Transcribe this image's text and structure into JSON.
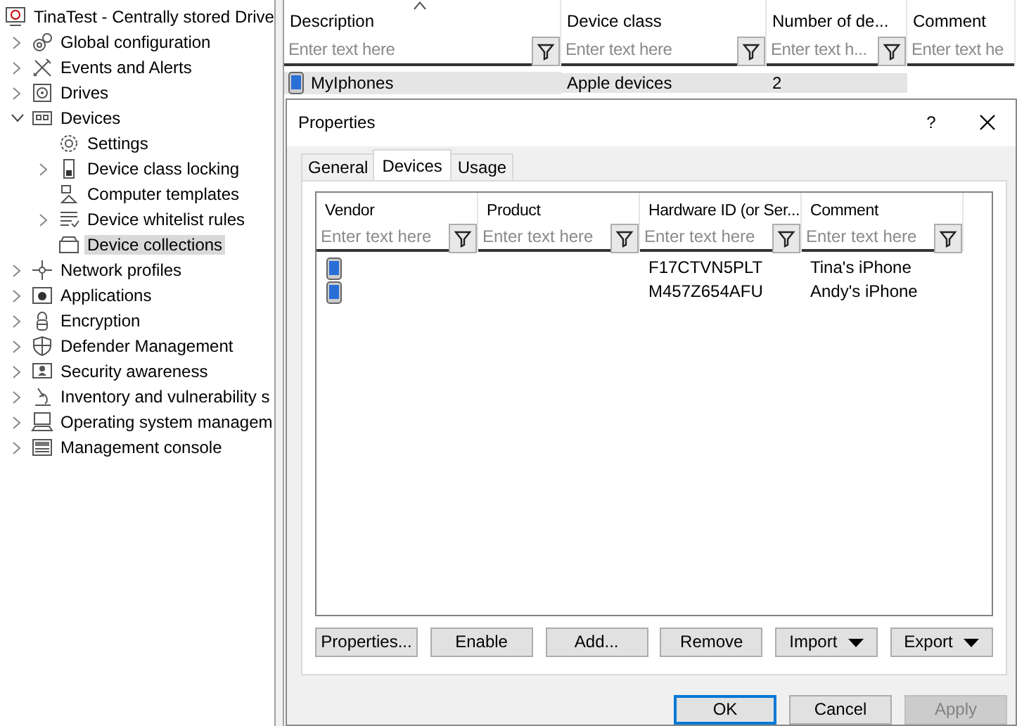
{
  "tree": {
    "root": "TinaTest - Centrally stored Drive",
    "items": [
      {
        "label": "Global configuration",
        "expandable": true,
        "expanded": false,
        "selected": false
      },
      {
        "label": "Events and Alerts",
        "expandable": true,
        "expanded": false,
        "selected": false
      },
      {
        "label": "Drives",
        "expandable": true,
        "expanded": false,
        "selected": false
      },
      {
        "label": "Devices",
        "expandable": true,
        "expanded": true,
        "selected": false,
        "children": [
          {
            "label": "Settings",
            "expandable": false,
            "selected": false
          },
          {
            "label": "Device class locking",
            "expandable": true,
            "expanded": false,
            "selected": false
          },
          {
            "label": "Computer templates",
            "expandable": false,
            "selected": false
          },
          {
            "label": "Device whitelist rules",
            "expandable": true,
            "expanded": false,
            "selected": false
          },
          {
            "label": "Device collections",
            "expandable": false,
            "selected": true
          }
        ]
      },
      {
        "label": "Network profiles",
        "expandable": true,
        "expanded": false,
        "selected": false
      },
      {
        "label": "Applications",
        "expandable": true,
        "expanded": false,
        "selected": false
      },
      {
        "label": "Encryption",
        "expandable": true,
        "expanded": false,
        "selected": false
      },
      {
        "label": "Defender Management",
        "expandable": true,
        "expanded": false,
        "selected": false
      },
      {
        "label": "Security awareness",
        "expandable": true,
        "expanded": false,
        "selected": false
      },
      {
        "label": "Inventory and vulnerability s",
        "expandable": true,
        "expanded": false,
        "selected": false
      },
      {
        "label": "Operating system managem",
        "expandable": true,
        "expanded": false,
        "selected": false
      },
      {
        "label": "Management console",
        "expandable": true,
        "expanded": false,
        "selected": false
      }
    ]
  },
  "grid": {
    "columns": [
      {
        "title": "Description",
        "placeholder": "Enter text here",
        "sorted": true,
        "filter_button": true
      },
      {
        "title": "Device class",
        "placeholder": "Enter text here",
        "sorted": false,
        "filter_button": true
      },
      {
        "title": "Number of de...",
        "placeholder": "Enter text h...",
        "sorted": false,
        "filter_button": true
      },
      {
        "title": "Comment",
        "placeholder": "Enter text he",
        "sorted": false,
        "filter_button": false
      }
    ],
    "rows": [
      {
        "selected": true,
        "cells": [
          "MyIphones",
          "Apple devices",
          "2"
        ]
      }
    ]
  },
  "dialog": {
    "title": "Properties",
    "help": "?",
    "tabs": [
      {
        "label": "General",
        "selected": false
      },
      {
        "label": "Devices",
        "selected": true
      },
      {
        "label": "Usage",
        "selected": false
      }
    ],
    "columns": [
      {
        "title": "Vendor",
        "placeholder": "Enter text here"
      },
      {
        "title": "Product",
        "placeholder": "Enter text here"
      },
      {
        "title": "Hardware ID (or Ser...",
        "placeholder": "Enter text here"
      },
      {
        "title": "Comment",
        "placeholder": "Enter text here"
      }
    ],
    "rows": [
      {
        "hardware_id": "F17CTVN5PLT",
        "comment": "Tina's iPhone"
      },
      {
        "hardware_id": "M457Z654AFU",
        "comment": "Andy's iPhone"
      }
    ],
    "actions": [
      {
        "label": "Properties...",
        "dropdown": false
      },
      {
        "label": "Enable",
        "dropdown": false
      },
      {
        "label": "Add...",
        "dropdown": false
      },
      {
        "label": "Remove",
        "dropdown": false
      },
      {
        "label": "Import",
        "dropdown": true
      },
      {
        "label": "Export",
        "dropdown": true
      }
    ],
    "footer": [
      {
        "label": "OK",
        "default": true,
        "disabled": false
      },
      {
        "label": "Cancel",
        "default": false,
        "disabled": false
      },
      {
        "label": "Apply",
        "default": false,
        "disabled": true
      }
    ]
  }
}
